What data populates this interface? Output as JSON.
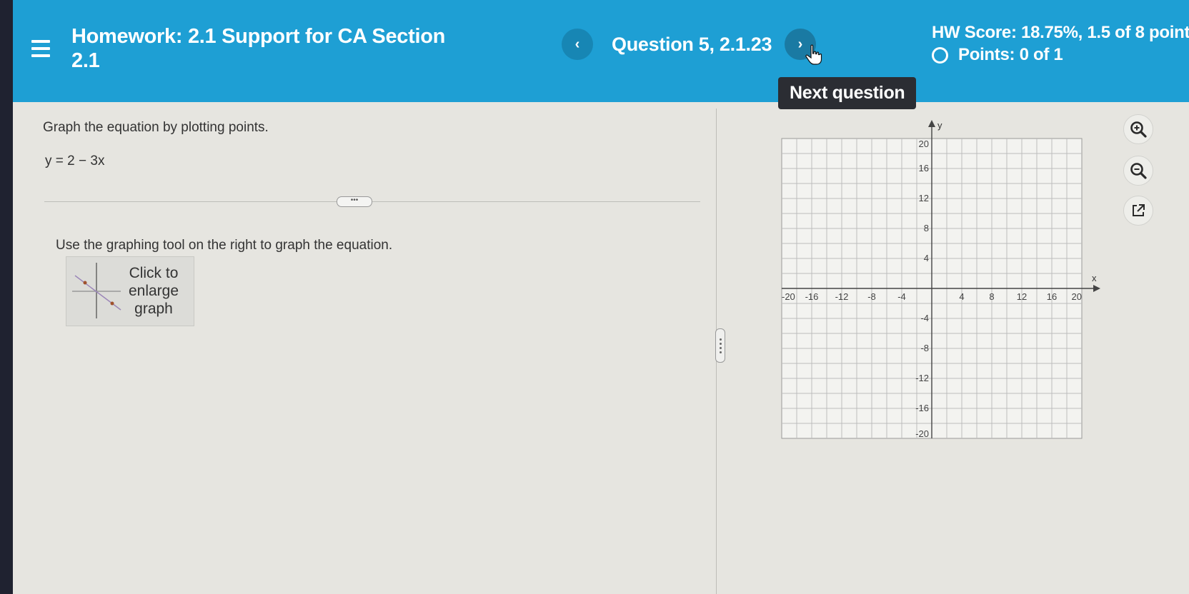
{
  "header": {
    "title": "Homework: 2.1 Support for CA Section 2.1",
    "prev_label": "‹",
    "question_label": "Question 5, 2.1.23",
    "next_label": "›",
    "tooltip": "Next question",
    "hw_score": "HW Score: 18.75%, 1.5 of 8 points",
    "points": "Points: 0 of 1"
  },
  "problem": {
    "prompt": "Graph the equation by plotting points.",
    "equation": "y = 2 − 3x",
    "expand_label": "•••",
    "instruction": "Use the graphing tool on the right to graph the equation.",
    "thumb_label": "Click to enlarge graph"
  },
  "graph": {
    "x_axis_label": "x",
    "y_axis_label": "y",
    "x_ticks": [
      "-20",
      "-16",
      "-12",
      "-8",
      "-4",
      "4",
      "8",
      "12",
      "16",
      "20"
    ],
    "y_ticks": [
      "20",
      "16",
      "12",
      "8",
      "4",
      "-4",
      "-8",
      "-12",
      "-16",
      "-20"
    ],
    "xlim": [
      -20,
      20
    ],
    "ylim": [
      -20,
      20
    ],
    "grid_step": 2
  },
  "tools": [
    "zoom-in-icon",
    "zoom-out-icon",
    "popout-icon"
  ],
  "colors": {
    "header": "#1e9fd4",
    "tooltip": "#2b2d33",
    "grid": "#bdbdbd"
  }
}
